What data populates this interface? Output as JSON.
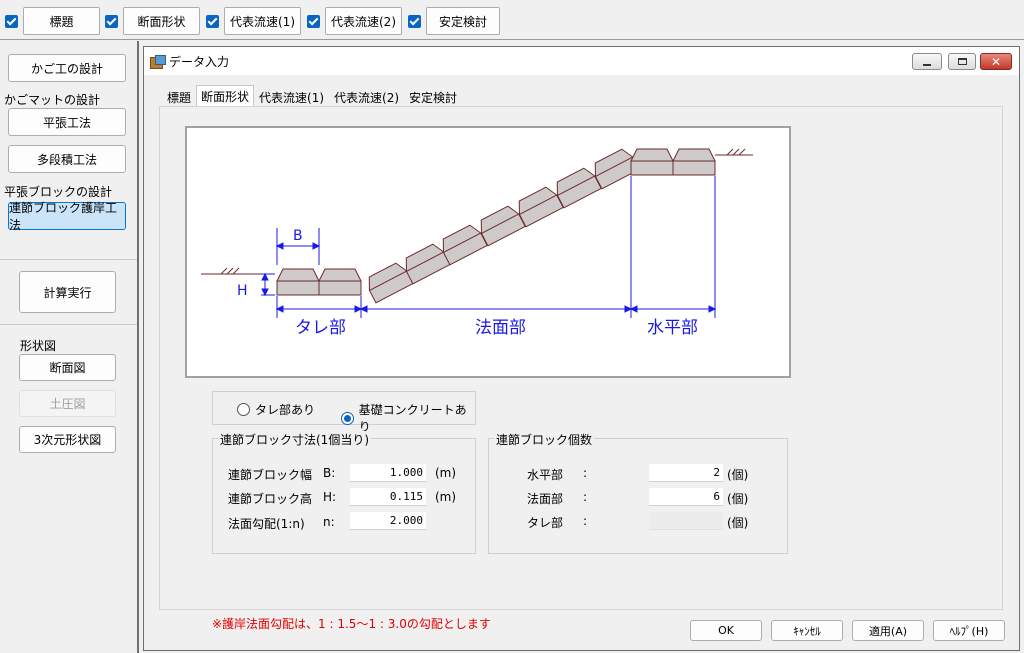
{
  "toolbar": {
    "items": [
      {
        "label": "標題"
      },
      {
        "label": "断面形状"
      },
      {
        "label": "代表流速(1)"
      },
      {
        "label": "代表流速(2)"
      },
      {
        "label": "安定検討"
      }
    ]
  },
  "left_panel": {
    "kago_button": "かご工の設計",
    "kagomat_label": "かごマットの設計",
    "heihari_button": "平張工法",
    "tadanseki_button": "多段積工法",
    "block_label": "平張ブロックの設計",
    "renketsu_button": "連節ブロック護岸工法",
    "calc_button": "計算実行",
    "shape_label": "形状図",
    "section_button": "断面図",
    "earth_button": "土圧図",
    "three_d_button": "3次元形状図"
  },
  "dialog": {
    "title": "データ入力",
    "tabs": [
      "標題",
      "断面形状",
      "代表流速(1)",
      "代表流速(2)",
      "安定検討"
    ],
    "selected_tab": 1,
    "diagram": {
      "label_b": "B",
      "label_h": "H",
      "label_tare": "タレ部",
      "label_nori": "法面部",
      "label_suihei": "水平部"
    },
    "radio": {
      "option1": "タレ部あり",
      "option2": "基礎コンクリートあり",
      "selected": 2
    },
    "dims": {
      "title": "連節ブロック寸法(1個当り)",
      "width_label": "連節ブロック幅",
      "width_sym": "B:",
      "width_value": "1.000",
      "width_unit": "(m)",
      "height_label": "連節ブロック高",
      "height_sym": "H:",
      "height_value": "0.115",
      "height_unit": "(m)",
      "slope_label": "法面勾配(1:n)",
      "slope_sym": "n:",
      "slope_value": "2.000"
    },
    "counts": {
      "title": "連節ブロック個数",
      "suihei_label": "水平部",
      "suihei_value": "2",
      "nori_label": "法面部",
      "nori_value": "6",
      "tare_label": "タレ部",
      "tare_value": "",
      "colon": ":",
      "unit": "(個)"
    },
    "note": "※護岸法面勾配は、1 : 1.5〜1 : 3.0の勾配とします",
    "buttons": {
      "ok": "OK",
      "cancel": "ｷｬﾝｾﾙ",
      "apply": "適用(A)",
      "help": "ﾍﾙﾌﾟ(H)"
    }
  },
  "colors": {
    "accent": "#0a64c4",
    "note": "#e00000",
    "dimension": "#1a1ae6",
    "block_fill": "#cfcaca",
    "block_stroke": "#6b2a2a"
  }
}
